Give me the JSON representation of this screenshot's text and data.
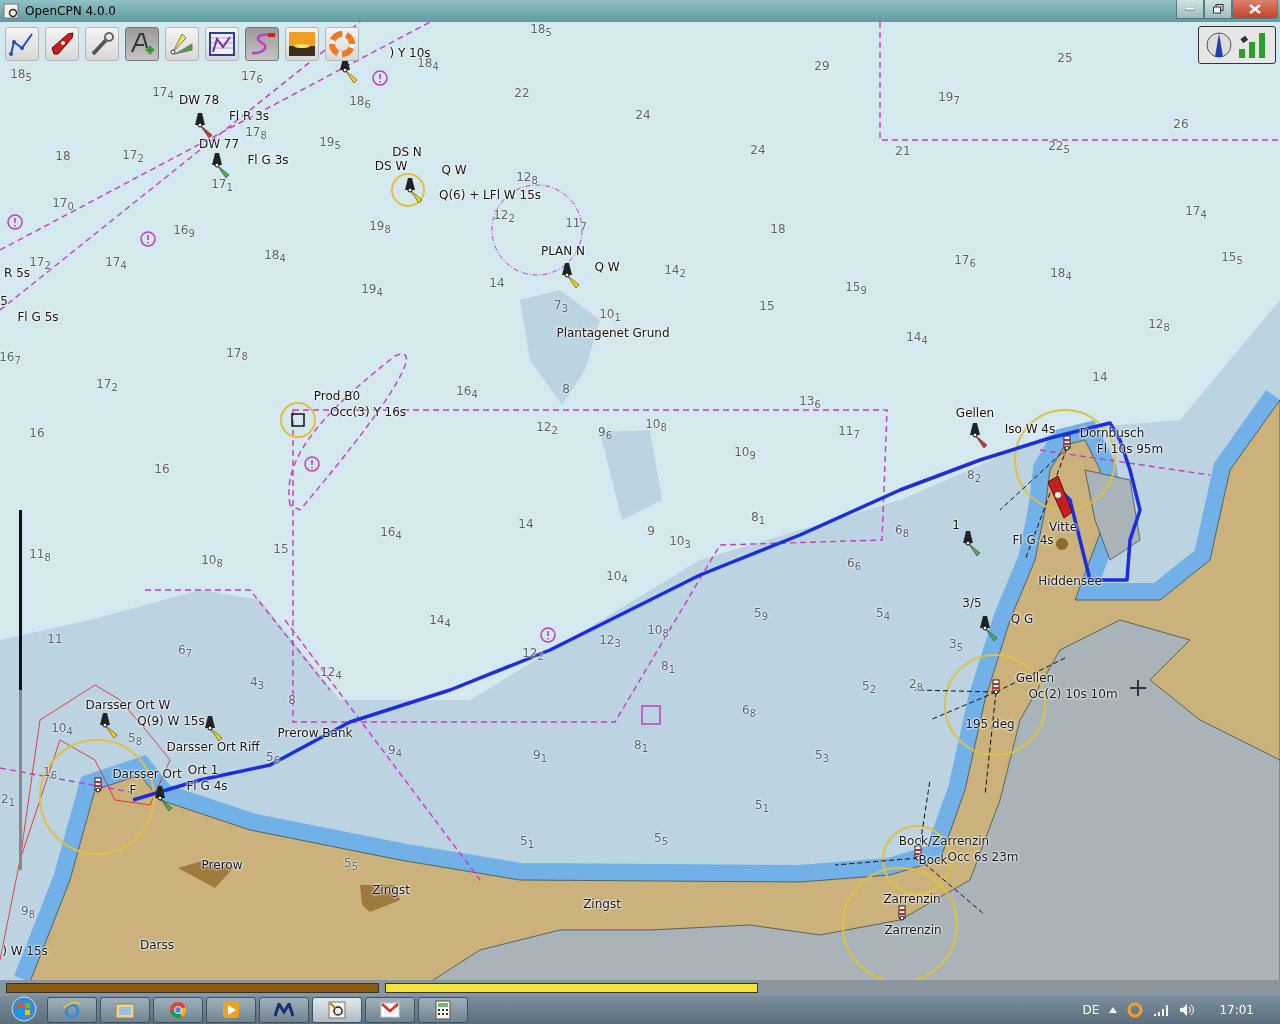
{
  "window": {
    "title": "OpenCPN 4.0.0"
  },
  "toolbar": {
    "buttons": [
      {
        "kind": "route",
        "on": false
      },
      {
        "kind": "ship",
        "on": false
      },
      {
        "kind": "settings",
        "on": false
      },
      {
        "kind": "text",
        "on": true
      },
      {
        "kind": "sectors",
        "on": false
      },
      {
        "kind": "route-manager",
        "on": false
      },
      {
        "kind": "track",
        "on": true
      },
      {
        "kind": "sunset",
        "on": false
      },
      {
        "kind": "lifebuoy",
        "on": false
      }
    ]
  },
  "chart": {
    "labels": [
      ") Y 10s",
      "DW 78",
      "Fl R 3s",
      "DW 77",
      "Fl G 3s",
      "DS N",
      "DS W",
      "Q W",
      "Q(6) + LFl W 15s",
      "R 5s",
      "5",
      "Fl G 5s",
      "PLAN N",
      "Q W",
      "Plantagenet Grund",
      "Prod B0",
      "Occ(3) Y 16s",
      "Gellen",
      "Iso W 4s",
      "Dornbusch",
      "Fl 10s 95m",
      "1",
      "Vitte",
      "Fl G 4s",
      "Hiddensee",
      "3/5",
      "Q G",
      "Gellen",
      "Oc(2) 10s 10m",
      "195 deg",
      "Darsser Ort W",
      "Q(9) W 15s",
      "Prerow Bank",
      "Darsser Ort Riff",
      "Darsser Ort",
      "Ort 1",
      "Fl G 4s",
      "F",
      "Prerow",
      "Zingst",
      "Zingst",
      "Bock/Zarrenzin",
      "Bock",
      "Occ 6s 23m",
      "Zarrenzin",
      "Zarrenzin",
      "Darss",
      ") W 15s"
    ],
    "soundings": [
      "18$_{5}$",
      "18$_{4}$",
      "18$_{5}$",
      "17$_{6}$",
      "17$_{4}$",
      "18$_{6}$",
      "22",
      "29",
      "25",
      "19$_{7}$",
      "26",
      "17$_{8}$",
      "19$_{5}$",
      "18",
      "17$_{2}$",
      "24",
      "24",
      "21",
      "22$_{5}$",
      "17$_{0}$",
      "17$_{1}$",
      "12$_{8}$",
      "12$_{2}$",
      "11$_{7}$",
      "16$_{9}$",
      "19$_{8}$",
      "18",
      "17$_{4}$",
      "17$_{2}$",
      "17$_{4}$",
      "18$_{4}$",
      "14",
      "14$_{2}$",
      "17$_{6}$",
      "18$_{4}$",
      "15$_{5}$",
      "19$_{4}$",
      "7$_{3}$",
      "10$_{1}$",
      "15",
      "15$_{9}$",
      "12$_{8}$",
      "16$_{7}$",
      "17$_{8}$",
      "14$_{4}$",
      "14",
      "17$_{2}$",
      "16$_{4}$",
      "8",
      "13$_{6}$",
      "16",
      "12$_{2}$",
      "9$_{6}$",
      "10$_{8}$",
      "11$_{7}$",
      "10$_{9}$",
      "8$_{2}$",
      "16",
      "14",
      "9",
      "10$_{3}$",
      "8$_{1}$",
      "16$_{4}$",
      "6$_{8}$",
      "11$_{8}$",
      "10$_{8}$",
      "15",
      "6$_{6}$",
      "10$_{4}$",
      "5$_{4}$",
      "5$_{9}$",
      "14$_{4}$",
      "12$_{3}$",
      "10$_{8}$",
      "12$_{2}$",
      "11",
      "6$_{7}$",
      "4$_{3}$",
      "8$_{1}$",
      "12$_{4}$",
      "3$_{5}$",
      "5$_{2}$",
      "2$_{8}$",
      "6$_{8}$",
      "8$_{1}$",
      "9$_{4}$",
      "9$_{1}$",
      "5$_{3}$",
      "10$_{4}$",
      "5$_{8}$",
      "5$_{6}$",
      "1$_{6}$",
      "2$_{1}$",
      "5$_{1}$",
      "5$_{1}$",
      "5$_{5}$",
      "5$_{5}$",
      "9$_{8}$",
      "8"
    ]
  },
  "taskbar": {
    "apps": [
      {
        "kind": "browser-e",
        "active": false
      },
      {
        "kind": "folder",
        "active": false
      },
      {
        "kind": "chrome",
        "active": false
      },
      {
        "kind": "media",
        "active": false
      },
      {
        "kind": "m-logo",
        "active": false
      },
      {
        "kind": "opencpn",
        "active": true
      },
      {
        "kind": "mail",
        "active": false
      },
      {
        "kind": "calculator",
        "active": false
      }
    ],
    "language": "DE",
    "clock": "17:01"
  }
}
